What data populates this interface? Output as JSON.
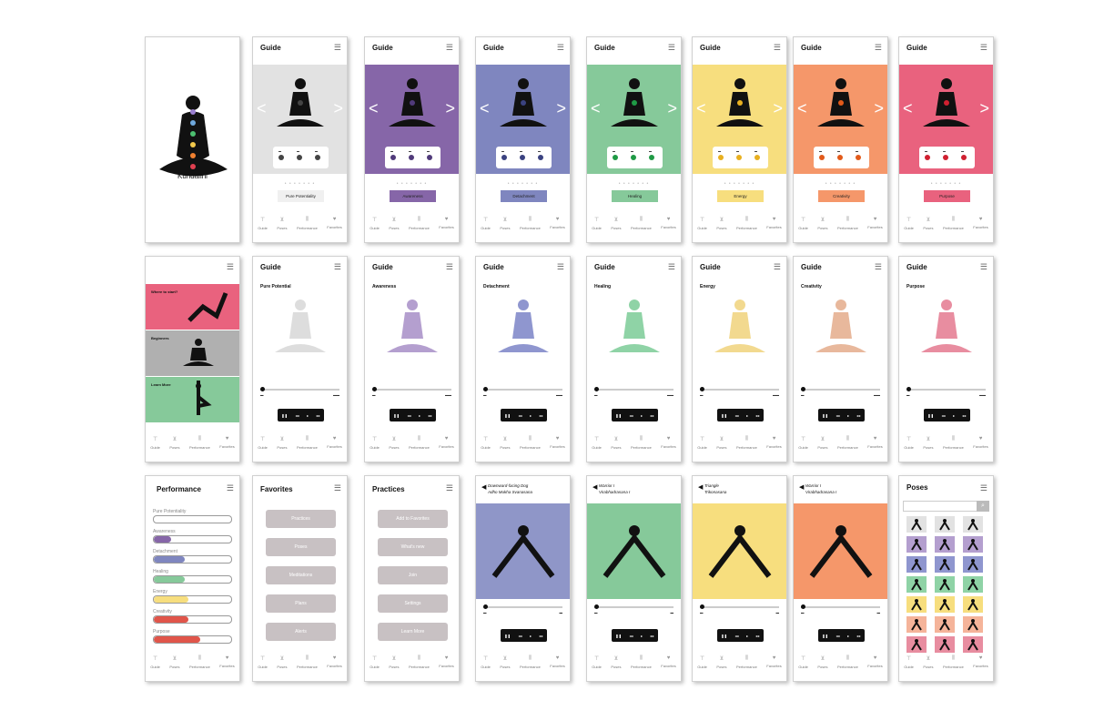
{
  "splash": {
    "label": "Kundalini"
  },
  "guide_title": "Guide",
  "nav": [
    "Guide",
    "Poses",
    "Performance",
    "Favorites"
  ],
  "carousel": [
    {
      "color": "#e2e2e2",
      "label": "Pure Potentiality",
      "accent": "#f0f0f0",
      "dot": "#444"
    },
    {
      "color": "#8666a8",
      "label": "Awareness",
      "accent": "#8666a8",
      "dot": "#503a7a"
    },
    {
      "color": "#7f86bf",
      "label": "Detachment",
      "accent": "#7f86bf",
      "dot": "#3a4280"
    },
    {
      "color": "#86c99a",
      "label": "Healing",
      "accent": "#86c99a",
      "dot": "#1f9a45"
    },
    {
      "color": "#f7de7e",
      "label": "Energy",
      "accent": "#f7de7e",
      "dot": "#e8b020"
    },
    {
      "color": "#f5976a",
      "label": "Creativity",
      "accent": "#f5976a",
      "dot": "#e25a1a"
    },
    {
      "color": "#e9627e",
      "label": "Purpose",
      "accent": "#e9627e",
      "dot": "#d02030"
    }
  ],
  "menu_screen": {
    "items": [
      "Where to start?",
      "Beginners",
      "Learn More"
    ],
    "colors": [
      "#e9627e",
      "#b0b0b0",
      "#86c99a"
    ]
  },
  "practice": [
    {
      "title": "Pure Potential",
      "color": "#dddddd"
    },
    {
      "title": "Awareness",
      "color": "#b49fcf"
    },
    {
      "title": "Detachment",
      "color": "#8f96cf"
    },
    {
      "title": "Healing",
      "color": "#8fd3a6"
    },
    {
      "title": "Energy",
      "color": "#f2d98f"
    },
    {
      "title": "Creativity",
      "color": "#e8b89c"
    },
    {
      "title": "Purpose",
      "color": "#e88da0"
    }
  ],
  "performance": {
    "title": "Performance",
    "rows": [
      {
        "label": "Pure Potentiality",
        "fill": 0.0,
        "color": "#ddd"
      },
      {
        "label": "Awareness",
        "fill": 0.22,
        "color": "#8666a8"
      },
      {
        "label": "Detachment",
        "fill": 0.4,
        "color": "#7f86bf"
      },
      {
        "label": "Healing",
        "fill": 0.4,
        "color": "#86c99a"
      },
      {
        "label": "Energy",
        "fill": 0.45,
        "color": "#f7de7e"
      },
      {
        "label": "Creativity",
        "fill": 0.45,
        "color": "#e0554a"
      },
      {
        "label": "Purpose",
        "fill": 0.6,
        "color": "#e0554a"
      }
    ]
  },
  "favorites": {
    "title": "Favorites",
    "buttons": [
      "Practices",
      "Poses",
      "Meditations",
      "Plans",
      "Alerts"
    ]
  },
  "practices": {
    "title": "Practices",
    "buttons": [
      "Add to Favorites",
      "What's new",
      "Join",
      "Settings",
      "Learn More"
    ]
  },
  "poses_detail": [
    {
      "name": "Downward-facing Dog",
      "sub": "Adho Mukha Svanasana",
      "color": "#8f96c8"
    },
    {
      "name": "Warrior I",
      "sub": "Virabhadrasana I",
      "color": "#86c99a"
    },
    {
      "name": "Triangle",
      "sub": "Trikonasana",
      "color": "#f7de7e"
    },
    {
      "name": "Warrior I",
      "sub": "Virabhadrasana I",
      "color": "#f5976a"
    }
  ],
  "poses_grid": {
    "title": "Poses",
    "search_placeholder": "",
    "colors": [
      "#e2e2e2",
      "#b49fcf",
      "#8f96cf",
      "#8fd3a6",
      "#f7de7e",
      "#f5b49a",
      "#e88da0"
    ]
  }
}
